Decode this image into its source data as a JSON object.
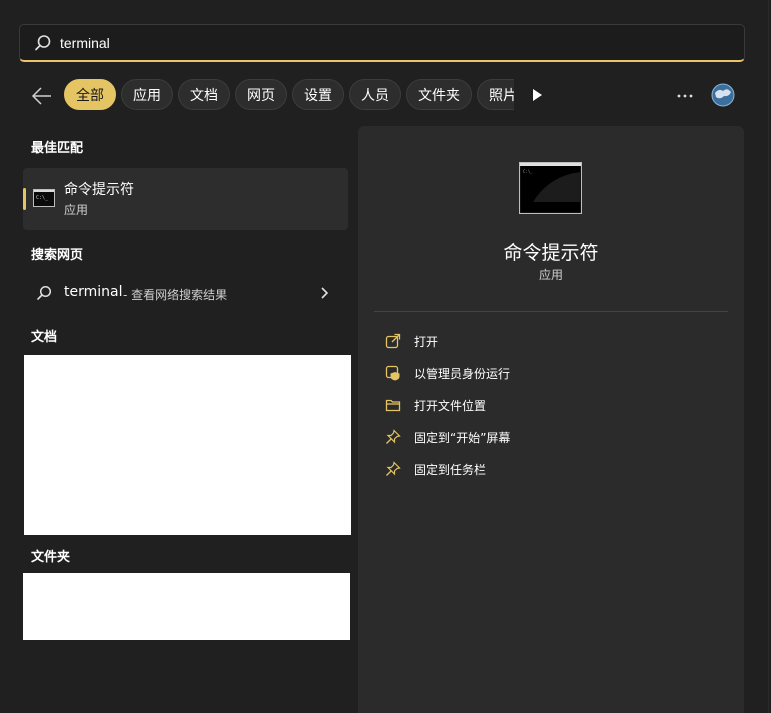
{
  "search": {
    "value": "terminal",
    "icon": "search-icon"
  },
  "filters": {
    "items": [
      {
        "label": "全部",
        "active": true
      },
      {
        "label": "应用",
        "active": false
      },
      {
        "label": "文档",
        "active": false
      },
      {
        "label": "网页",
        "active": false
      },
      {
        "label": "设置",
        "active": false
      },
      {
        "label": "人员",
        "active": false
      },
      {
        "label": "文件夹",
        "active": false
      },
      {
        "label": "照片",
        "active": false
      }
    ]
  },
  "best_match": {
    "heading": "最佳匹配",
    "title": "命令提示符",
    "subtitle": "应用"
  },
  "web_search": {
    "heading": "搜索网页",
    "term": "terminal",
    "hint": "- 查看网络搜索结果"
  },
  "documents": {
    "heading": "文档"
  },
  "folders": {
    "heading": "文件夹"
  },
  "detail": {
    "title": "命令提示符",
    "subtitle": "应用",
    "actions": [
      {
        "label": "打开",
        "icon": "open-external-icon"
      },
      {
        "label": "以管理员身份运行",
        "icon": "shield-admin-icon"
      },
      {
        "label": "打开文件位置",
        "icon": "folder-icon"
      },
      {
        "label": "固定到“开始”屏幕",
        "icon": "pin-icon"
      },
      {
        "label": "固定到任务栏",
        "icon": "pin-icon"
      }
    ]
  },
  "colors": {
    "accent": "#e5c463",
    "background": "#202020",
    "panel": "#2b2b2b"
  }
}
